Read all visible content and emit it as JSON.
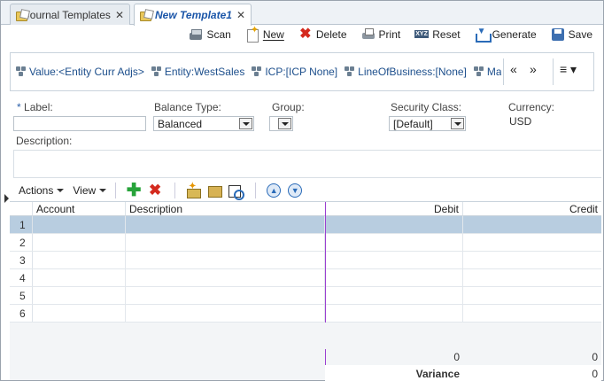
{
  "tabs": [
    {
      "label": "Journal Templates",
      "active": false
    },
    {
      "label": "New Template1",
      "active": true
    }
  ],
  "toolbar": {
    "scan": "Scan",
    "new": "New",
    "delete": "Delete",
    "print": "Print",
    "reset": "Reset",
    "generate": "Generate",
    "save": "Save"
  },
  "pov": {
    "items": [
      "Value:<Entity Curr Adjs>",
      "Entity:WestSales",
      "ICP:[ICP None]",
      "LineOfBusiness:[None]",
      "Markets"
    ],
    "prev": "«",
    "next": "»",
    "menu": "≡ ▾"
  },
  "form": {
    "label_label": "Label:",
    "label_req": "*",
    "label_value": "",
    "balance_type_label": "Balance Type:",
    "balance_type_value": "Balanced",
    "group_label": "Group:",
    "group_value": "",
    "security_class_label": "Security Class:",
    "security_class_value": "[Default]",
    "currency_label": "Currency:",
    "currency_value": "USD",
    "description_label": "Description:",
    "description_value": ""
  },
  "grid_toolbar": {
    "actions": "Actions",
    "view": "View"
  },
  "grid": {
    "columns": [
      "Account",
      "Description",
      "Debit",
      "Credit"
    ],
    "rows": [
      "1",
      "2",
      "3",
      "4",
      "5",
      "6"
    ],
    "selected_row": 1,
    "debit_total": "0",
    "credit_total": "0",
    "variance_label": "Variance",
    "variance_value": "0"
  },
  "colors": {
    "accent": "#1a55a8",
    "selection": "#b8cde0",
    "splitter": "#9b3fd1"
  }
}
